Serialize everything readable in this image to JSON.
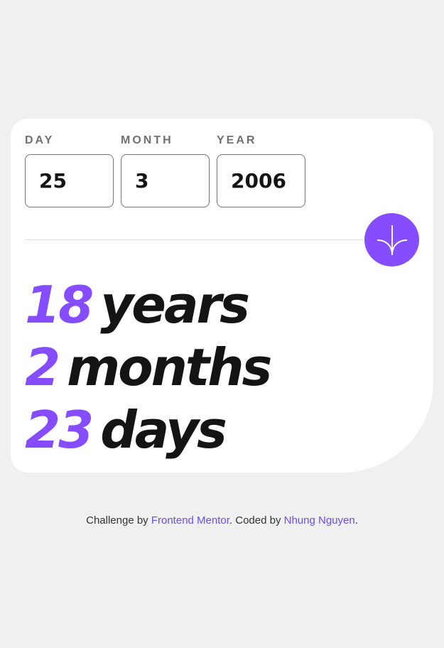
{
  "form": {
    "day": {
      "label": "DAY",
      "value": "25"
    },
    "month": {
      "label": "MONTH",
      "value": "3"
    },
    "year": {
      "label": "YEAR",
      "value": "2006"
    }
  },
  "submit": {
    "icon": "arrow-down-icon",
    "color": "#854dff"
  },
  "results": {
    "years": {
      "value": "18",
      "unit": "years"
    },
    "months": {
      "value": "2",
      "unit": "months"
    },
    "days": {
      "value": "23",
      "unit": "days"
    }
  },
  "footer": {
    "prefix": "Challenge by ",
    "link1": "Frontend Mentor",
    "middle": ". Coded by ",
    "link2": "Nhung Nguyen",
    "suffix": "."
  },
  "colors": {
    "accent": "#854dff",
    "background": "#f0f0f0",
    "text": "#141414",
    "label": "#716f6f"
  }
}
